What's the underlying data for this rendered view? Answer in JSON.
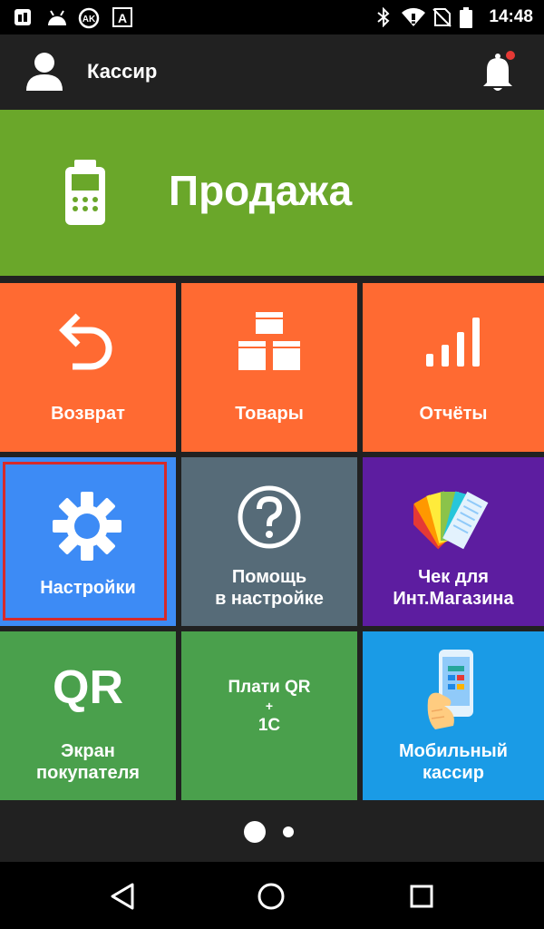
{
  "status_bar": {
    "time": "14:48",
    "left_icons": [
      "sim-icon",
      "android-icon",
      "ak-icon",
      "font-icon"
    ],
    "right_icons": [
      "bluetooth-icon",
      "wifi-icon",
      "no-sim-icon",
      "battery-icon"
    ]
  },
  "app_bar": {
    "user_name": "Кассир",
    "icons": [
      "avatar-icon",
      "bell-icon"
    ],
    "notification_color": "#e53935"
  },
  "tiles": {
    "sale": {
      "label": "Продажа",
      "icon": "terminal-icon",
      "color": "#6aa72a"
    },
    "return": {
      "label": "Возврат",
      "icon": "undo-icon",
      "color": "#ff6a32"
    },
    "goods": {
      "label": "Товары",
      "icon": "boxes-icon",
      "color": "#ff6a32"
    },
    "reports": {
      "label": "Отчёты",
      "icon": "bars-icon",
      "color": "#ff6a32"
    },
    "settings": {
      "label": "Настройки",
      "icon": "gear-icon",
      "color": "#3d8bf5",
      "highlighted": true,
      "highlight_color": "#d62a2a"
    },
    "help": {
      "line1": "Помощь",
      "line2": "в настройке",
      "icon": "question-icon",
      "color": "#566b78"
    },
    "receipt": {
      "line1": "Чек для",
      "line2": "Инт.Магазина",
      "icon": "cards-fan-icon",
      "color": "#5d1da0"
    },
    "customer_screen": {
      "icon_text": "QR",
      "line1": "Экран",
      "line2": "покупателя",
      "color": "#4aa04c"
    },
    "pay_qr": {
      "line1": "Плати QR",
      "line2": "+",
      "line3": "1С",
      "color": "#4aa04c"
    },
    "mobile_cashier": {
      "line1": "Мобильный",
      "line2": "кассир",
      "icon": "phone-hand-icon",
      "color": "#1a9be6"
    }
  },
  "pager": {
    "pages": 2,
    "current": 1
  },
  "nav_bar": {
    "buttons": [
      "back-icon",
      "home-icon",
      "recents-icon"
    ]
  }
}
